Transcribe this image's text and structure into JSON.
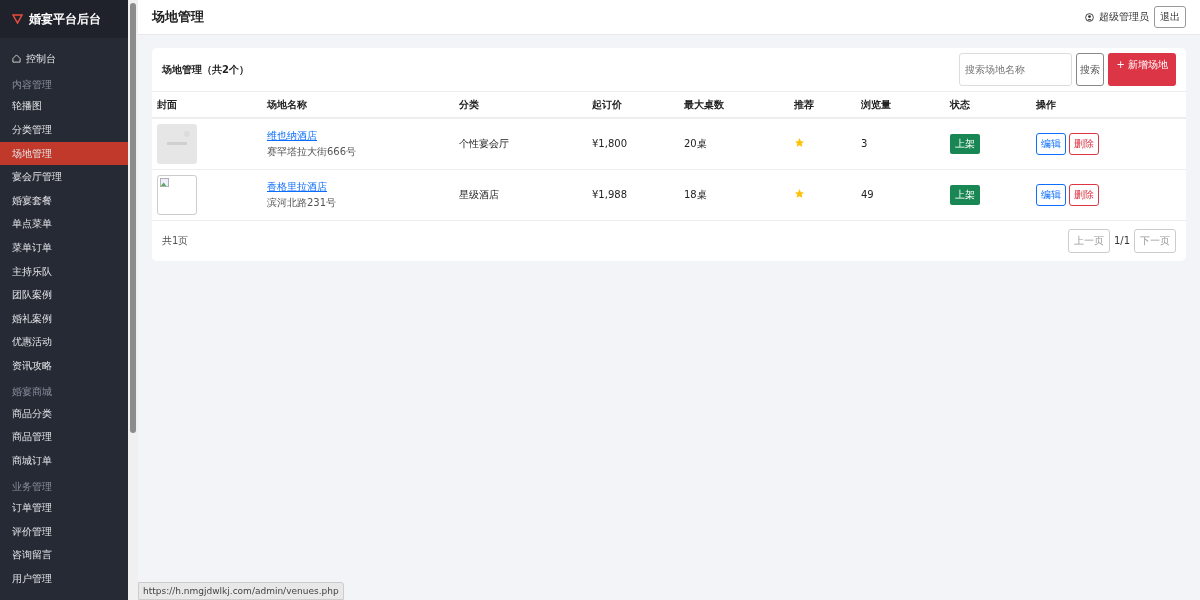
{
  "brand": {
    "title": "婚宴平台后台"
  },
  "sidebar": {
    "items": [
      {
        "kind": "item",
        "label": "控制台",
        "icon": true,
        "selected": false
      },
      {
        "kind": "group",
        "label": "内容管理"
      },
      {
        "kind": "item",
        "label": "轮播图",
        "selected": false
      },
      {
        "kind": "item",
        "label": "分类管理",
        "selected": false
      },
      {
        "kind": "item",
        "label": "场地管理",
        "selected": true
      },
      {
        "kind": "item",
        "label": "宴会厅管理",
        "selected": false
      },
      {
        "kind": "item",
        "label": "婚宴套餐",
        "selected": false
      },
      {
        "kind": "item",
        "label": "单点菜单",
        "selected": false
      },
      {
        "kind": "item",
        "label": "菜单订单",
        "selected": false
      },
      {
        "kind": "item",
        "label": "主持乐队",
        "selected": false
      },
      {
        "kind": "item",
        "label": "团队案例",
        "selected": false
      },
      {
        "kind": "item",
        "label": "婚礼案例",
        "selected": false
      },
      {
        "kind": "item",
        "label": "优惠活动",
        "selected": false
      },
      {
        "kind": "item",
        "label": "资讯攻略",
        "selected": false
      },
      {
        "kind": "group",
        "label": "婚宴商城"
      },
      {
        "kind": "item",
        "label": "商品分类",
        "selected": false
      },
      {
        "kind": "item",
        "label": "商品管理",
        "selected": false
      },
      {
        "kind": "item",
        "label": "商城订单",
        "selected": false
      },
      {
        "kind": "group",
        "label": "业务管理"
      },
      {
        "kind": "item",
        "label": "订单管理",
        "selected": false
      },
      {
        "kind": "item",
        "label": "评价管理",
        "selected": false
      },
      {
        "kind": "item",
        "label": "咨询留言",
        "selected": false
      },
      {
        "kind": "item",
        "label": "用户管理",
        "selected": false
      }
    ]
  },
  "header": {
    "title": "场地管理",
    "user": "超级管理员",
    "logout": "退出"
  },
  "card": {
    "title": "场地管理（共2个）",
    "search": {
      "placeholder": "搜索场地名称"
    },
    "search_button": "搜索",
    "add_button": "+ 新增场地"
  },
  "table": {
    "columns": [
      "封面",
      "场地名称",
      "分类",
      "起订价",
      "最大桌数",
      "推荐",
      "浏览量",
      "状态",
      "操作"
    ],
    "rows": [
      {
        "name": "维也纳酒店",
        "address": "赛罕塔拉大街666号",
        "category": "个性宴会厅",
        "price": "¥1,800",
        "tables": "20桌",
        "recommended": true,
        "views": "3",
        "status": "上架",
        "edit": "编辑",
        "delete": "删除"
      },
      {
        "cover": {
          "kind": "broken"
        },
        "name": "香格里拉酒店",
        "address": "滨河北路231号",
        "category": "星级酒店",
        "price": "¥1,988",
        "tables": "18桌",
        "recommended": true,
        "views": "49",
        "status": "上架",
        "edit": "编辑",
        "delete": "删除"
      }
    ]
  },
  "pagination": {
    "summary": "共1页",
    "prev": "上一页",
    "page": "1/1",
    "next": "下一页"
  },
  "status_url": "https://h.nmgjdwlkj.com/admin/venues.php"
}
